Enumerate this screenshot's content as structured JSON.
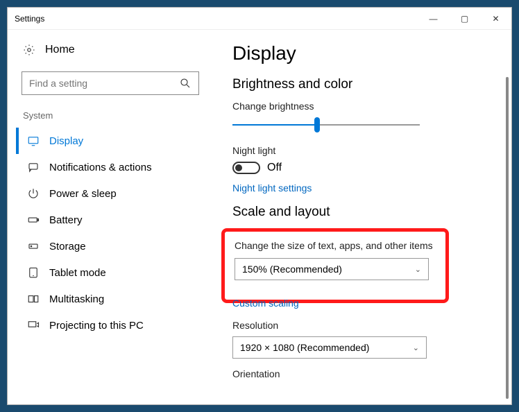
{
  "titlebar": {
    "title": "Settings"
  },
  "sidebar": {
    "home": "Home",
    "search_placeholder": "Find a setting",
    "group": "System",
    "items": [
      {
        "label": "Display"
      },
      {
        "label": "Notifications & actions"
      },
      {
        "label": "Power & sleep"
      },
      {
        "label": "Battery"
      },
      {
        "label": "Storage"
      },
      {
        "label": "Tablet mode"
      },
      {
        "label": "Multitasking"
      },
      {
        "label": "Projecting to this PC"
      }
    ]
  },
  "main": {
    "title": "Display",
    "brightness_section": "Brightness and color",
    "brightness_label": "Change brightness",
    "night_light_label": "Night light",
    "night_light_state": "Off",
    "night_light_link": "Night light settings",
    "scale_section": "Scale and layout",
    "scale_label": "Change the size of text, apps, and other items",
    "scale_value": "150% (Recommended)",
    "custom_scaling_link": "Custom scaling",
    "resolution_label": "Resolution",
    "resolution_value": "1920 × 1080 (Recommended)",
    "orientation_label": "Orientation"
  }
}
